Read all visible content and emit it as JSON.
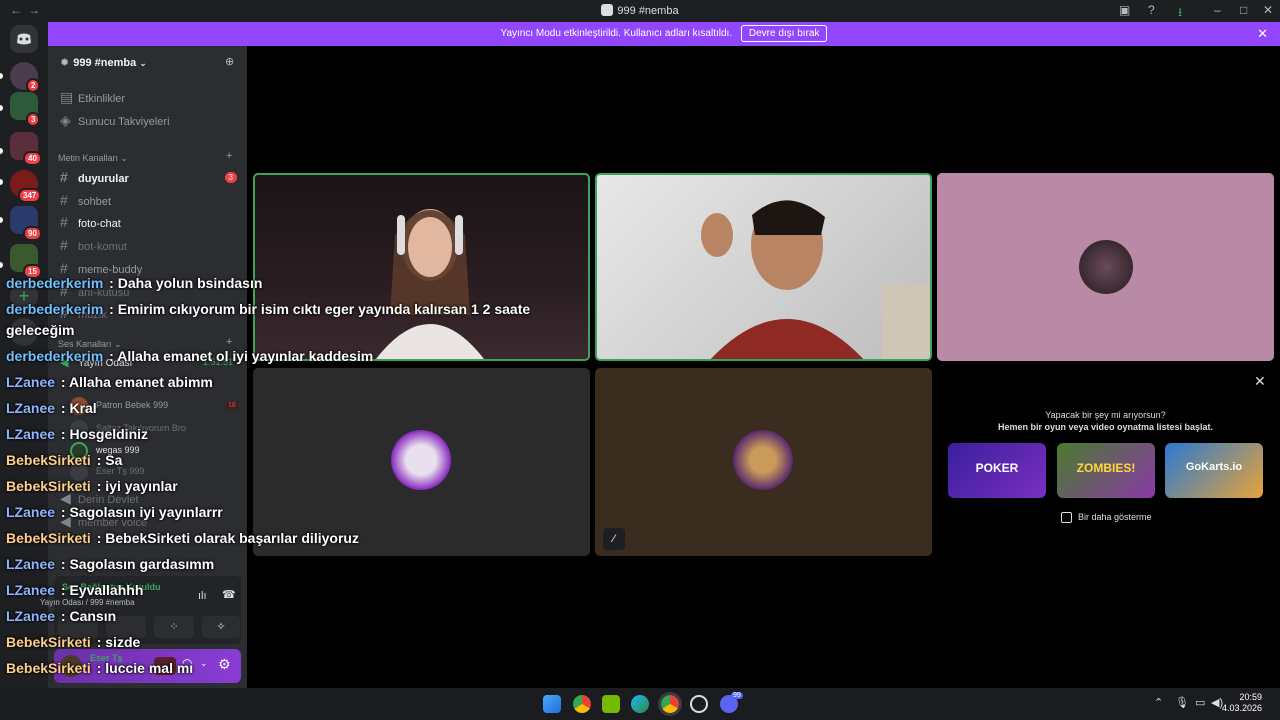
{
  "window": {
    "title": "999 #nemba",
    "back": "←",
    "forward": "→"
  },
  "banner": {
    "text": "Yayıncı Modu etkinleştirildi. Kullanıcı adları kısaltıldı.",
    "button": "Devre dışı bırak",
    "close": "✕"
  },
  "rail": {
    "badges": [
      "2",
      "3",
      "40",
      "347",
      "90",
      "15"
    ]
  },
  "sidebar": {
    "server_name": "999 #nemba",
    "items": [
      {
        "label": "Etkinlikler"
      },
      {
        "label": "Sunucu Takviyeleri"
      }
    ],
    "text_category": "Metin Kanalları",
    "text_channels": [
      {
        "name": "duyurular",
        "badge": "3"
      },
      {
        "name": "sohbet"
      },
      {
        "name": "foto-chat"
      },
      {
        "name": "bot-komut"
      },
      {
        "name": "meme-buddy"
      },
      {
        "name": "anı-kutusu"
      },
      {
        "name": "muzik"
      }
    ],
    "voice_category": "Ses Kanalları",
    "voice_channel": {
      "name": "Yayın Odası",
      "timer": "1:51:51"
    },
    "voice_users": [
      {
        "name": "Patron Bebek",
        "tag": "999",
        "badge": "18"
      },
      {
        "name": "Saltaz Takılıyorum Bro",
        "tag": ""
      },
      {
        "name": "wegas",
        "tag": "999"
      },
      {
        "name": "Eser Tş",
        "tag": "999"
      }
    ],
    "other_voice": [
      "Derin Devlet",
      "member voice"
    ],
    "voice_status": {
      "connected": "Ses Bağlantısı Kuruldu",
      "location": "Yayın Odası / 999 #nemba"
    },
    "user": {
      "name": "Eser Tş"
    }
  },
  "stage": {
    "prompt_title": "Yapacak bir şey mi arıyorsun?",
    "prompt_sub": "Hemen bir oyun veya video oynatma listesi başlat.",
    "games": [
      "POKER",
      "ZOMBIES!",
      "GoKarts.io"
    ],
    "dont_show": "Bir daha gösterme",
    "close": "✕"
  },
  "chat": [
    {
      "user": "derbederkerim",
      "text": " : Daha yolun bsindasın",
      "color": "#6fc2ff"
    },
    {
      "user": "derbederkerim",
      "text": " : Emirim cıkıyorum bir isim cıktı eger yayında kalırsan 1 2 saate",
      "color": "#6fc2ff"
    },
    {
      "user": "",
      "text": "geleceğim",
      "color": "#6fc2ff"
    },
    {
      "user": "derbederkerim",
      "text": " : Allaha emanet ol iyi yayınlar kaddesim",
      "color": "#6fc2ff"
    },
    {
      "user": "LZanee",
      "text": " : Allaha emanet abimm",
      "color": "#8fb4ff"
    },
    {
      "user": "LZanee",
      "text": " : Kral",
      "color": "#8fb4ff"
    },
    {
      "user": "LZanee",
      "text": " : Hosgeldiniz",
      "color": "#8fb4ff"
    },
    {
      "user": "BebekSirketi",
      "text": " : Sa",
      "color": "#ffcf8a"
    },
    {
      "user": "BebekSirketi",
      "text": " : iyi yayınlar",
      "color": "#ffcf8a"
    },
    {
      "user": "LZanee",
      "text": " : Sagolasın iyi yayınlarrr",
      "color": "#8fb4ff"
    },
    {
      "user": "BebekSirketi",
      "text": " : BebekSirketi olarak başarılar diliyoruz",
      "color": "#ffcf8a"
    },
    {
      "user": "LZanee",
      "text": " : Sagolasın gardasımm",
      "color": "#8fb4ff"
    },
    {
      "user": "LZanee",
      "text": " : Eyvallahhh",
      "color": "#8fb4ff"
    },
    {
      "user": "LZanee",
      "text": " : Cansın",
      "color": "#8fb4ff"
    },
    {
      "user": "BebekSirketi",
      "text": " : sizde",
      "color": "#ffcf8a"
    },
    {
      "user": "BebekSirketi",
      "text": " : luccie mal mı",
      "color": "#ffcf8a"
    }
  ],
  "taskbar": {
    "time": "20:59",
    "date": "4.03.2026",
    "discord_badge": "99"
  }
}
